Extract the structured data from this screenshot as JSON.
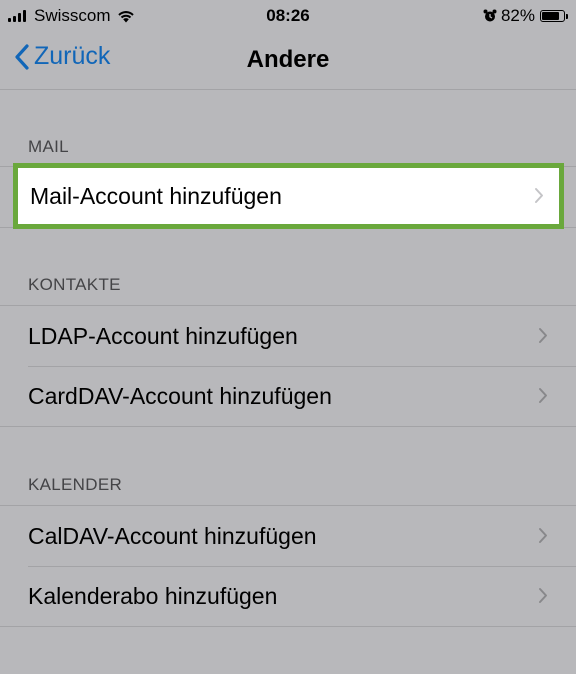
{
  "status_bar": {
    "carrier": "Swisscom",
    "time": "08:26",
    "battery_percent": "82%",
    "battery_level": 0.82
  },
  "nav": {
    "back_label": "Zurück",
    "title": "Andere"
  },
  "sections": {
    "mail": {
      "header": "MAIL",
      "items": [
        "Mail-Account hinzufügen"
      ]
    },
    "contacts": {
      "header": "KONTAKTE",
      "items": [
        "LDAP-Account hinzufügen",
        "CardDAV-Account hinzufügen"
      ]
    },
    "calendar": {
      "header": "KALENDER",
      "items": [
        "CalDAV-Account hinzufügen",
        "Kalenderabo hinzufügen"
      ]
    }
  },
  "colors": {
    "accent": "#1166b8",
    "highlight_border": "#6aa83c"
  }
}
